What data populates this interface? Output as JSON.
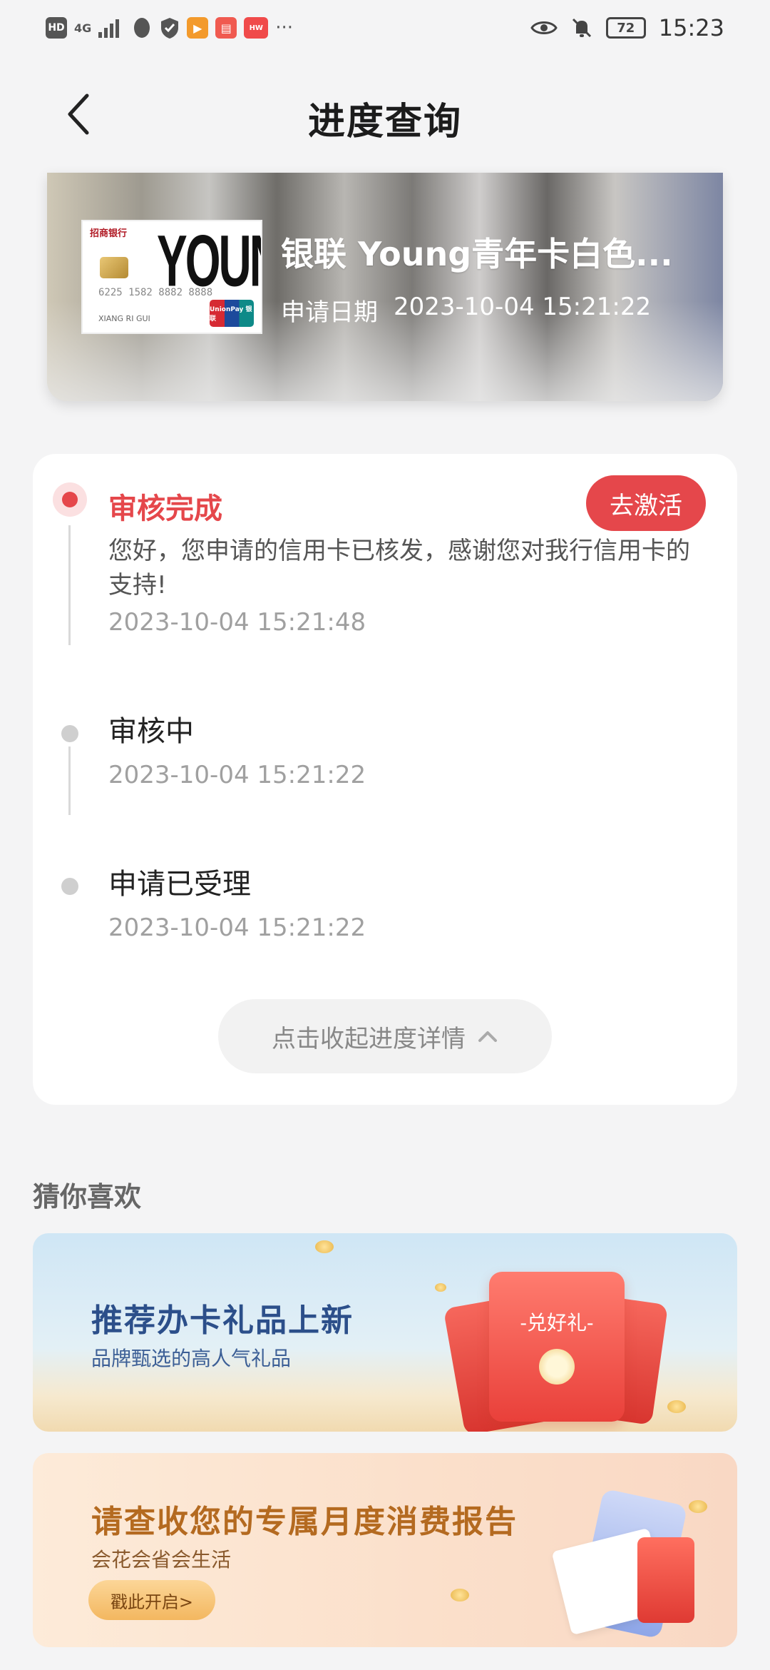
{
  "status_bar": {
    "network_badge": "HD",
    "signal_label": "4G",
    "battery": "72",
    "time": "15:23",
    "more_indicator": "···"
  },
  "nav": {
    "title": "进度查询"
  },
  "card": {
    "name": "银联 Young青年卡白色...",
    "date_label": "申请日期",
    "date_value": "2023-10-04 15:21:22",
    "image": {
      "bank_logo": "招商银行",
      "brand": "YOUNG",
      "number": "6225 1582 8882 8888",
      "holder": "XIANG RI GUI",
      "network": "UnionPay 银联"
    }
  },
  "progress": {
    "steps": [
      {
        "title": "审核完成",
        "desc": "您好，您申请的信用卡已核发，感谢您对我行信用卡的支持!",
        "time": "2023-10-04 15:21:48",
        "action": "去激活"
      },
      {
        "title": "审核中",
        "time": "2023-10-04 15:21:22"
      },
      {
        "title": "申请已受理",
        "time": "2023-10-04 15:21:22"
      }
    ],
    "collapse_label": "点击收起进度详情"
  },
  "recommend": {
    "title": "猜你喜欢",
    "banners": [
      {
        "headline": "推荐办卡礼品上新",
        "sub": "品牌甄选的高人气礼品",
        "packet_label": "-兑好礼-"
      },
      {
        "headline": "请查收您的专属月度消费报告",
        "sub": "会花会省会生活",
        "button": "戳此开启>"
      }
    ]
  },
  "colors": {
    "accent": "#e5474b",
    "background": "#f4f4f5"
  }
}
